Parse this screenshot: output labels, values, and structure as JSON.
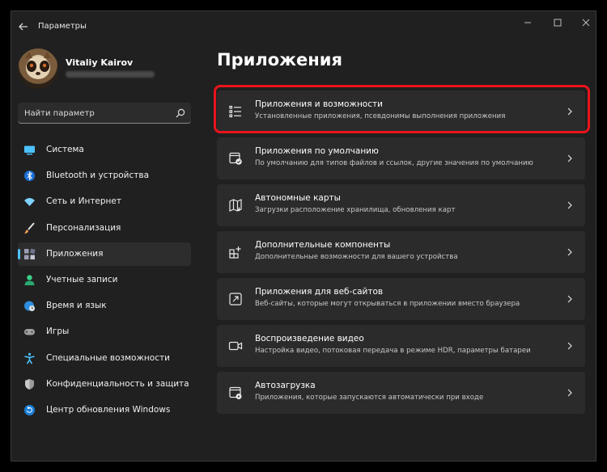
{
  "window": {
    "title": "Параметры"
  },
  "user": {
    "name": "Vitaliy Kairov"
  },
  "search": {
    "placeholder": "Найти параметр"
  },
  "nav": {
    "items": [
      {
        "label": "Система",
        "icon": "monitor-icon",
        "color": "#4cc2ff"
      },
      {
        "label": "Bluetooth и устройства",
        "icon": "bluetooth-icon",
        "color": "#4cc2ff"
      },
      {
        "label": "Сеть и Интернет",
        "icon": "wifi-icon",
        "color": "#7fd4ff"
      },
      {
        "label": "Персонализация",
        "icon": "brush-icon",
        "color": "#f0a050"
      },
      {
        "label": "Приложения",
        "icon": "apps-icon",
        "color": "#9aa0b4",
        "active": true
      },
      {
        "label": "Учетные записи",
        "icon": "person-icon",
        "color": "#3ad08c"
      },
      {
        "label": "Время и язык",
        "icon": "globe-clock-icon",
        "color": "#4cc2ff"
      },
      {
        "label": "Игры",
        "icon": "gamepad-icon",
        "color": "#a0a0a0"
      },
      {
        "label": "Специальные возможности",
        "icon": "accessibility-icon",
        "color": "#4cc2ff"
      },
      {
        "label": "Конфиденциальность и защита",
        "icon": "shield-icon",
        "color": "#a0a0a0"
      },
      {
        "label": "Центр обновления Windows",
        "icon": "update-icon",
        "color": "#4cc2ff"
      }
    ]
  },
  "main": {
    "title": "Приложения",
    "cards": [
      {
        "title": "Приложения и возможности",
        "desc": "Установленные приложения, псевдонимы выполнения приложения",
        "icon": "list-icon",
        "highlighted": true
      },
      {
        "title": "Приложения по умолчанию",
        "desc": "По умолчанию для типов файлов и ссылок, другие значения по умолчанию",
        "icon": "default-apps-icon"
      },
      {
        "title": "Автономные карты",
        "desc": "Загрузки расположение хранилища, обновления карт",
        "icon": "map-icon"
      },
      {
        "title": "Дополнительные компоненты",
        "desc": "Дополнительные возможности для вашего устройства",
        "icon": "add-grid-icon"
      },
      {
        "title": "Приложения для веб-сайтов",
        "desc": "Веб-сайты, которые могут открываться в приложении вместо браузера",
        "icon": "open-link-icon"
      },
      {
        "title": "Воспроизведение видео",
        "desc": "Настройка видео, потоковая передача в режиме HDR, параметры батареи",
        "icon": "video-icon"
      },
      {
        "title": "Автозагрузка",
        "desc": "Приложения, которые запускаются автоматически при входе",
        "icon": "startup-icon"
      }
    ]
  },
  "colors": {
    "accent": "#4cc2ff",
    "highlight": "#e8141c",
    "background": "#202020",
    "card": "#2b2b2b"
  }
}
